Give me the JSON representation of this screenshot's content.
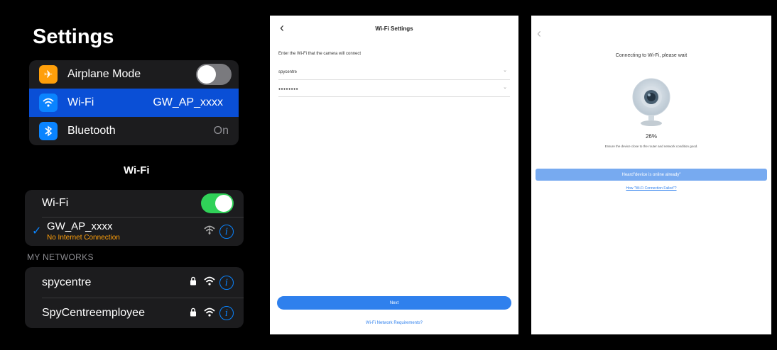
{
  "settings": {
    "title": "Settings",
    "rows": [
      {
        "label": "Airplane Mode",
        "icon": "airplane-icon",
        "icon_glyph": "✈",
        "icon_color": "#ff9f0a"
      },
      {
        "label": "Wi-Fi",
        "value": "GW_AP_xxxx",
        "icon": "wifi-icon",
        "icon_glyph": "◠",
        "icon_color": "#0a84ff"
      },
      {
        "label": "Bluetooth",
        "value": "On",
        "icon": "bluetooth-icon",
        "icon_glyph": "✱",
        "icon_color": "#0a84ff"
      }
    ],
    "wifi_section_title": "Wi-Fi",
    "wifi_toggle_label": "Wi-Fi",
    "connected_network": {
      "name": "GW_AP_xxxx",
      "status": "No Internet Connection",
      "status_color": "#ff9f0a",
      "check": "✓"
    },
    "my_networks_label": "MY NETWORKS",
    "networks": [
      {
        "name": "spycentre"
      },
      {
        "name": "SpyCentreemployee"
      }
    ],
    "highlight_color": "#0a4fd6",
    "toggle_on_color": "#30d158"
  },
  "wifi_settings": {
    "back": "‹",
    "title": "Wi-Fi Settings",
    "hint": "Enter the Wi-Fi that the camera will connect",
    "ssid_value": "spycentre",
    "password_value": "●●●●●●●●",
    "chevron": "⌄",
    "next_label": "Next",
    "requirements_link": "Wi-Fi Network Requirements?",
    "accent": "#2f80ed"
  },
  "connecting": {
    "back": "‹",
    "title": "Connecting to Wi-Fi, please wait",
    "progress_percent": 26,
    "progress_label": "26%",
    "note": "Ensure the device close to the router and network condition good.",
    "online_button": "Heard\"device is online already\"",
    "failed_link": "How \"Wi-Fi Connection Failed\"?"
  }
}
